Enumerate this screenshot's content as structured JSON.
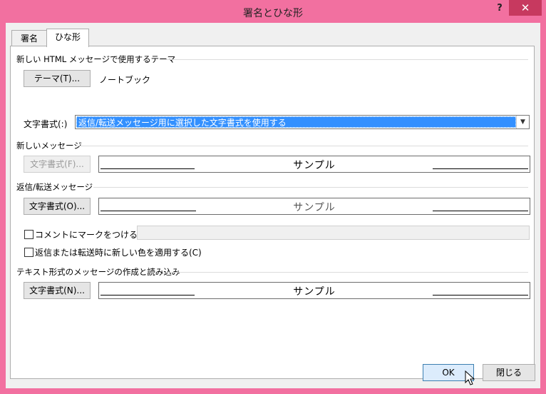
{
  "window": {
    "title": "署名とひな形",
    "help": "?",
    "close": "✕"
  },
  "tabs": [
    {
      "label": "署名"
    },
    {
      "label": "ひな形"
    }
  ],
  "theme_section": {
    "heading": "新しい HTML メッセージで使用するテーマ",
    "theme_button": "テーマ(T)...",
    "theme_value": "ノートブック",
    "font_label": "文字書式(:)",
    "font_select": "返信/転送メッセージ用に選択した文字書式を使用する"
  },
  "new_message": {
    "heading": "新しいメッセージ",
    "font_button": "文字書式(F)...",
    "sample": "サンプル"
  },
  "reply_forward": {
    "heading": "返信/転送メッセージ",
    "font_button": "文字書式(O)...",
    "sample": "サンプル",
    "mark_comments_label": "コメントにマークをつける(M):",
    "mark_comments_value": "",
    "color_label": "返信または転送時に新しい色を適用する(C)"
  },
  "plain_text": {
    "heading": "テキスト形式のメッセージの作成と読み込み",
    "font_button": "文字書式(N)...",
    "sample": "サンプル"
  },
  "footer": {
    "ok": "OK",
    "close": "閉じる"
  }
}
